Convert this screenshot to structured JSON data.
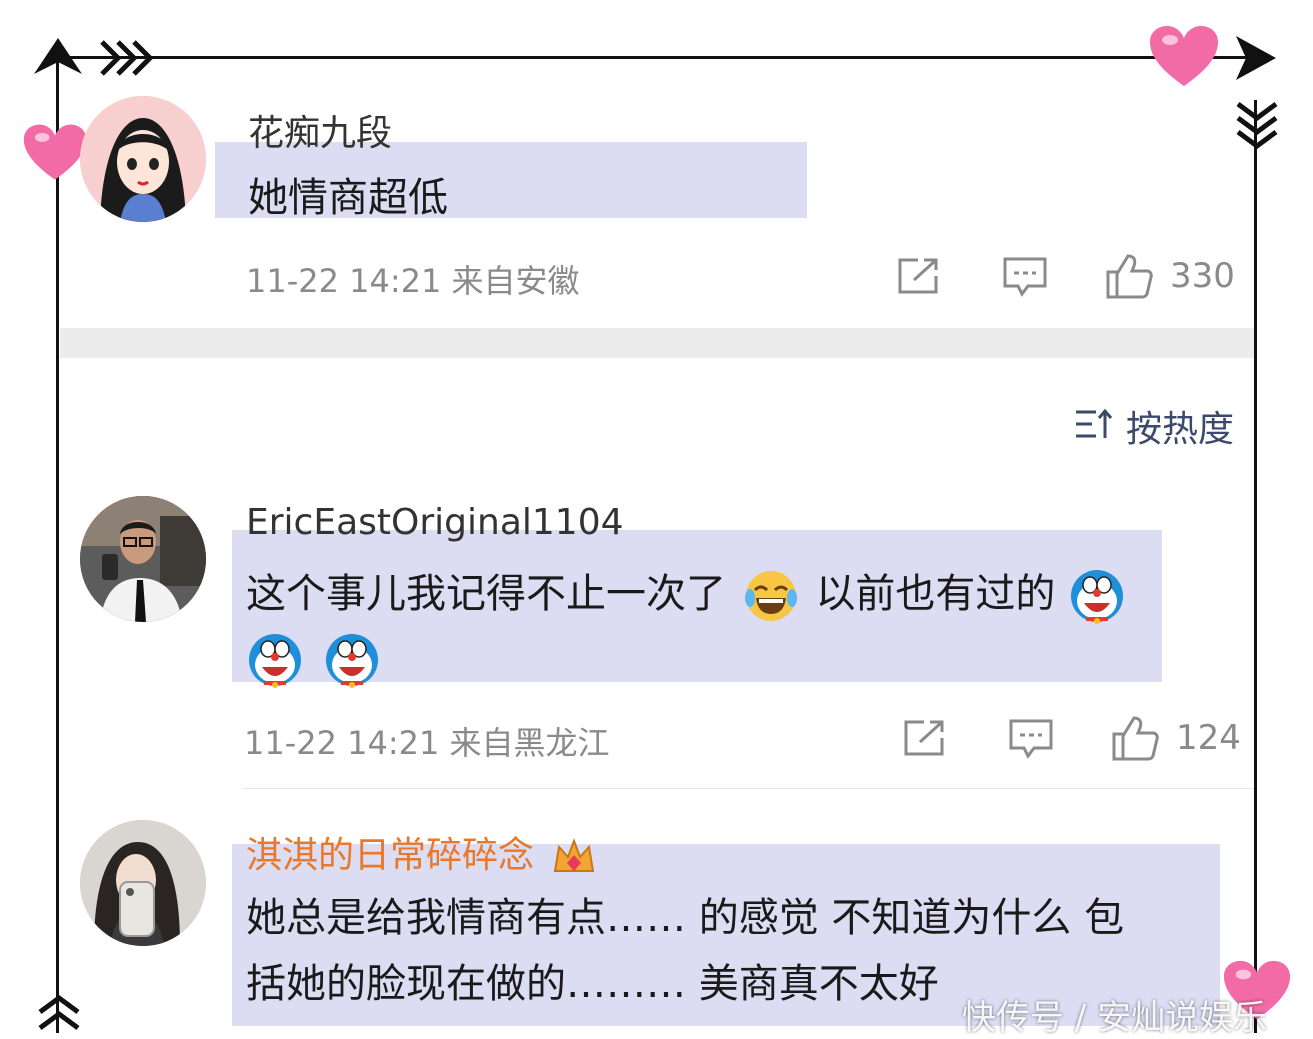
{
  "colors": {
    "highlight": "#dcdcf3",
    "vip_name": "#e8792a",
    "meta_gray": "#8a8a8a",
    "section_gap": "#ececec",
    "heart_pink": "#f26aa6"
  },
  "comments": [
    {
      "username": "花痴九段",
      "text_lines": [
        "她情商超低"
      ],
      "timestamp": "11-22 14:21 来自安徽",
      "likes": "330",
      "avatar": "cartoon-girl-avatar"
    },
    {
      "username": "EricEastOriginal1104",
      "text_lines": [
        "这个事儿我记得不止一次了",
        "以前也有过的"
      ],
      "emojis": [
        "laugh-cry-emoji",
        "doraemon-emoji",
        "doraemon-emoji",
        "doraemon-emoji"
      ],
      "timestamp": "11-22 14:21 来自黑龙江",
      "likes": "124",
      "avatar": "man-selfie-avatar"
    },
    {
      "username": "淇淇的日常碎碎念",
      "badge": "crown-badge-icon",
      "text_lines": [
        "她总是给我情商有点…… 的感觉 不知道为什么 包",
        "括她的脸现在做的……… 美商真不太好"
      ],
      "avatar": "woman-selfie-avatar"
    }
  ],
  "sort": {
    "label": "按热度",
    "icon": "sort-icon"
  },
  "watermark": "快传号 / 安灿说娱乐"
}
